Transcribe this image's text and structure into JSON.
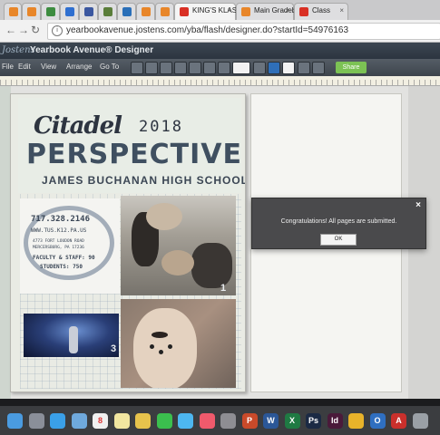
{
  "browser": {
    "tabs": [
      {
        "label": "",
        "color": "#e8862a"
      },
      {
        "label": "",
        "color": "#e8862a"
      },
      {
        "label": "",
        "color": "#3d8c40"
      },
      {
        "label": "",
        "color": "#2f6fd0"
      },
      {
        "label": "",
        "color": "#3b57a0"
      },
      {
        "label": "",
        "color": "#5a7d3a"
      },
      {
        "label": "",
        "color": "#2a6fb8"
      },
      {
        "label": "",
        "color": "#e8862a"
      },
      {
        "label": "",
        "color": "#e8862a"
      },
      {
        "label": "KING'S KLASS B",
        "color": "#d93025"
      },
      {
        "label": "Main Gradebook",
        "color": "#e8862a"
      },
      {
        "label": "Class",
        "color": "#d93025"
      }
    ],
    "url": "yearbookavenue.jostens.com/yba/flash/designer.do?startId=54976163"
  },
  "app": {
    "logo": "Jostens",
    "title": "Yearbook Avenue® Designer",
    "menus": [
      "File",
      "Edit",
      "View",
      "Arrange",
      "Go To"
    ],
    "share_label": "Share"
  },
  "cover": {
    "citadel": "Citadel",
    "year": "2018",
    "title": "PERSPECTIVE",
    "school": "JAMES BUCHANAN HIGH SCHOOL",
    "phone": "717.328.2146",
    "website": "WWW.TUS.K12.PA.US",
    "address1": "4773 FORT LOUDON ROAD",
    "address2": "MERCERSBURG, PA 17236",
    "faculty": "FACULTY & STAFF: 90",
    "students": "STUDENTS: 750",
    "page_nums": [
      "1",
      "2",
      "3"
    ]
  },
  "dialog": {
    "message": "Congratulations! All pages are submitted.",
    "ok_label": "OK",
    "close_label": "×"
  },
  "dock": {
    "icons": [
      {
        "name": "finder-icon",
        "color": "#4a9be0",
        "glyph": ""
      },
      {
        "name": "launchpad-icon",
        "color": "#8a8f99",
        "glyph": ""
      },
      {
        "name": "safari-icon",
        "color": "#3aa0e8",
        "glyph": ""
      },
      {
        "name": "mail-icon",
        "color": "#6fa9dc",
        "glyph": ""
      },
      {
        "name": "calendar-icon",
        "color": "#f0f0f0",
        "glyph": "8"
      },
      {
        "name": "notes-icon",
        "color": "#f1e6a0",
        "glyph": ""
      },
      {
        "name": "photos-icon",
        "color": "#e7c34c",
        "glyph": ""
      },
      {
        "name": "facetime-icon",
        "color": "#3bbf4e",
        "glyph": ""
      },
      {
        "name": "messages-icon",
        "color": "#4db7f0",
        "glyph": ""
      },
      {
        "name": "music-icon",
        "color": "#f05a6c",
        "glyph": ""
      },
      {
        "name": "preferences-icon",
        "color": "#8e8e93",
        "glyph": ""
      },
      {
        "name": "powerpoint-icon",
        "color": "#c94a2a",
        "glyph": "P"
      },
      {
        "name": "word-icon",
        "color": "#2b5797",
        "glyph": "W"
      },
      {
        "name": "excel-icon",
        "color": "#1f7a43",
        "glyph": "X"
      },
      {
        "name": "photoshop-icon",
        "color": "#1b2a44",
        "glyph": "Ps"
      },
      {
        "name": "indesign-icon",
        "color": "#4a1a3a",
        "glyph": "Id"
      },
      {
        "name": "chrome-icon",
        "color": "#e8b32a",
        "glyph": ""
      },
      {
        "name": "outlook-icon",
        "color": "#2f6fc0",
        "glyph": "O"
      },
      {
        "name": "acrobat-icon",
        "color": "#c9302c",
        "glyph": "A"
      },
      {
        "name": "trash-icon",
        "color": "#9aa0a6",
        "glyph": ""
      }
    ]
  }
}
